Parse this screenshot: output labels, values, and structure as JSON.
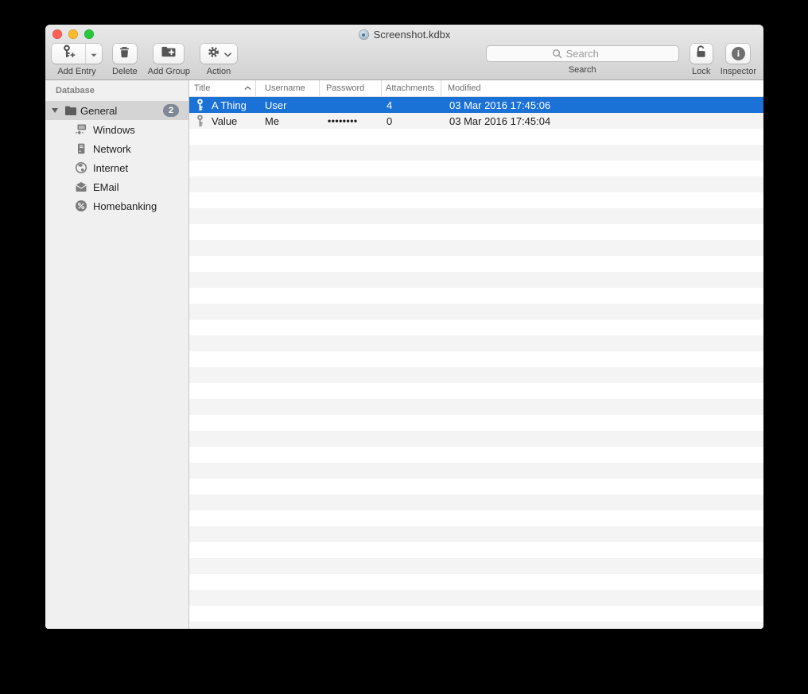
{
  "window": {
    "title": "Screenshot.kdbx"
  },
  "toolbar": {
    "add_entry": {
      "label": "Add Entry"
    },
    "delete": {
      "label": "Delete"
    },
    "add_group": {
      "label": "Add Group"
    },
    "action": {
      "label": "Action"
    },
    "search": {
      "label": "Search",
      "placeholder": "Search"
    },
    "lock": {
      "label": "Lock"
    },
    "inspector": {
      "label": "Inspector"
    }
  },
  "sidebar": {
    "header": "Database",
    "group": {
      "label": "General",
      "badge": "2"
    },
    "items": [
      {
        "label": "Windows",
        "icon": "windows-icon"
      },
      {
        "label": "Network",
        "icon": "network-icon"
      },
      {
        "label": "Internet",
        "icon": "globe-icon"
      },
      {
        "label": "EMail",
        "icon": "email-icon"
      },
      {
        "label": "Homebanking",
        "icon": "percent-icon"
      }
    ]
  },
  "table": {
    "columns": [
      {
        "label": "Title",
        "sorted": "ascending"
      },
      {
        "label": "Username"
      },
      {
        "label": "Password"
      },
      {
        "label": "Attachments"
      },
      {
        "label": "Modified"
      }
    ],
    "rows": [
      {
        "title": "A Thing",
        "username": "User",
        "password": "",
        "attachments": "4",
        "modified": "03 Mar 2016 17:45:06",
        "selected": true
      },
      {
        "title": "Value",
        "username": "Me",
        "password": "••••••••",
        "attachments": "0",
        "modified": "03 Mar 2016 17:45:04",
        "selected": false
      }
    ]
  },
  "colors": {
    "selection_blue": "#1a71d6",
    "stripe_gray": "#f4f4f4",
    "sidebar_bg": "#f0f0f0",
    "sidebar_selected": "#d4d4d4",
    "badge_gray": "#7d8894",
    "traffic_red": "#ff5f57",
    "traffic_yellow": "#febb2e",
    "traffic_green": "#28c83d"
  }
}
